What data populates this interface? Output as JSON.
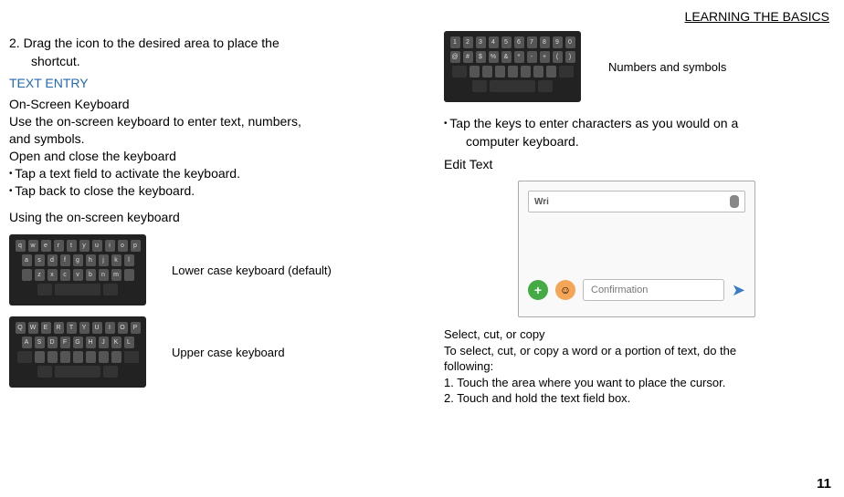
{
  "header": {
    "title": "LEARNING THE BASICS"
  },
  "left": {
    "step2_a": "2. Drag the icon to the desired area to place the",
    "step2_b": "shortcut.",
    "section_title": "TEXT ENTRY",
    "osk_head": "On-Screen Keyboard",
    "osk_desc1": "Use the on-screen keyboard to enter text, numbers,",
    "osk_desc2": "and symbols.",
    "open_close": "Open and close the keyboard",
    "bullet1": "Tap a text field to activate the keyboard.",
    "bullet2": "Tap back to close the keyboard.",
    "using": "Using the on-screen keyboard",
    "kb_lower_caption": "Lower case keyboard (default)",
    "kb_upper_caption": "Upper case keyboard"
  },
  "right": {
    "kb_num_caption": "Numbers and symbols",
    "tap_a": "Tap the keys to enter characters as you would on a",
    "tap_b": "computer keyboard.",
    "edit_title": "Edit Text",
    "editimg_top": "Wri",
    "editimg_conf": "Confirmation",
    "sel_head": "Select, cut, or copy",
    "sel_body1": "To select, cut, or copy a word or a portion of text, do the",
    "sel_body2": "following:",
    "sel_step1": "1. Touch the area where you want to place the cursor.",
    "sel_step2": "2. Touch and hold the text field box."
  },
  "page_number": "11",
  "kb_lower": {
    "r1": [
      "q",
      "w",
      "e",
      "r",
      "t",
      "y",
      "u",
      "i",
      "o",
      "p"
    ],
    "r2": [
      "a",
      "s",
      "d",
      "f",
      "g",
      "h",
      "j",
      "k",
      "l"
    ],
    "r3": [
      "",
      "z",
      "x",
      "c",
      "v",
      "b",
      "n",
      "m",
      ""
    ]
  },
  "kb_upper": {
    "r1": [
      "Q",
      "W",
      "E",
      "R",
      "T",
      "Y",
      "U",
      "I",
      "O",
      "P"
    ],
    "r2": [
      "A",
      "S",
      "D",
      "F",
      "G",
      "H",
      "J",
      "K",
      "L"
    ]
  },
  "kb_num": {
    "r1": [
      "1",
      "2",
      "3",
      "4",
      "5",
      "6",
      "7",
      "8",
      "9",
      "0"
    ],
    "r2": [
      "@",
      "#",
      "$",
      "%",
      "&",
      "*",
      "-",
      "+",
      "(",
      ")"
    ]
  }
}
